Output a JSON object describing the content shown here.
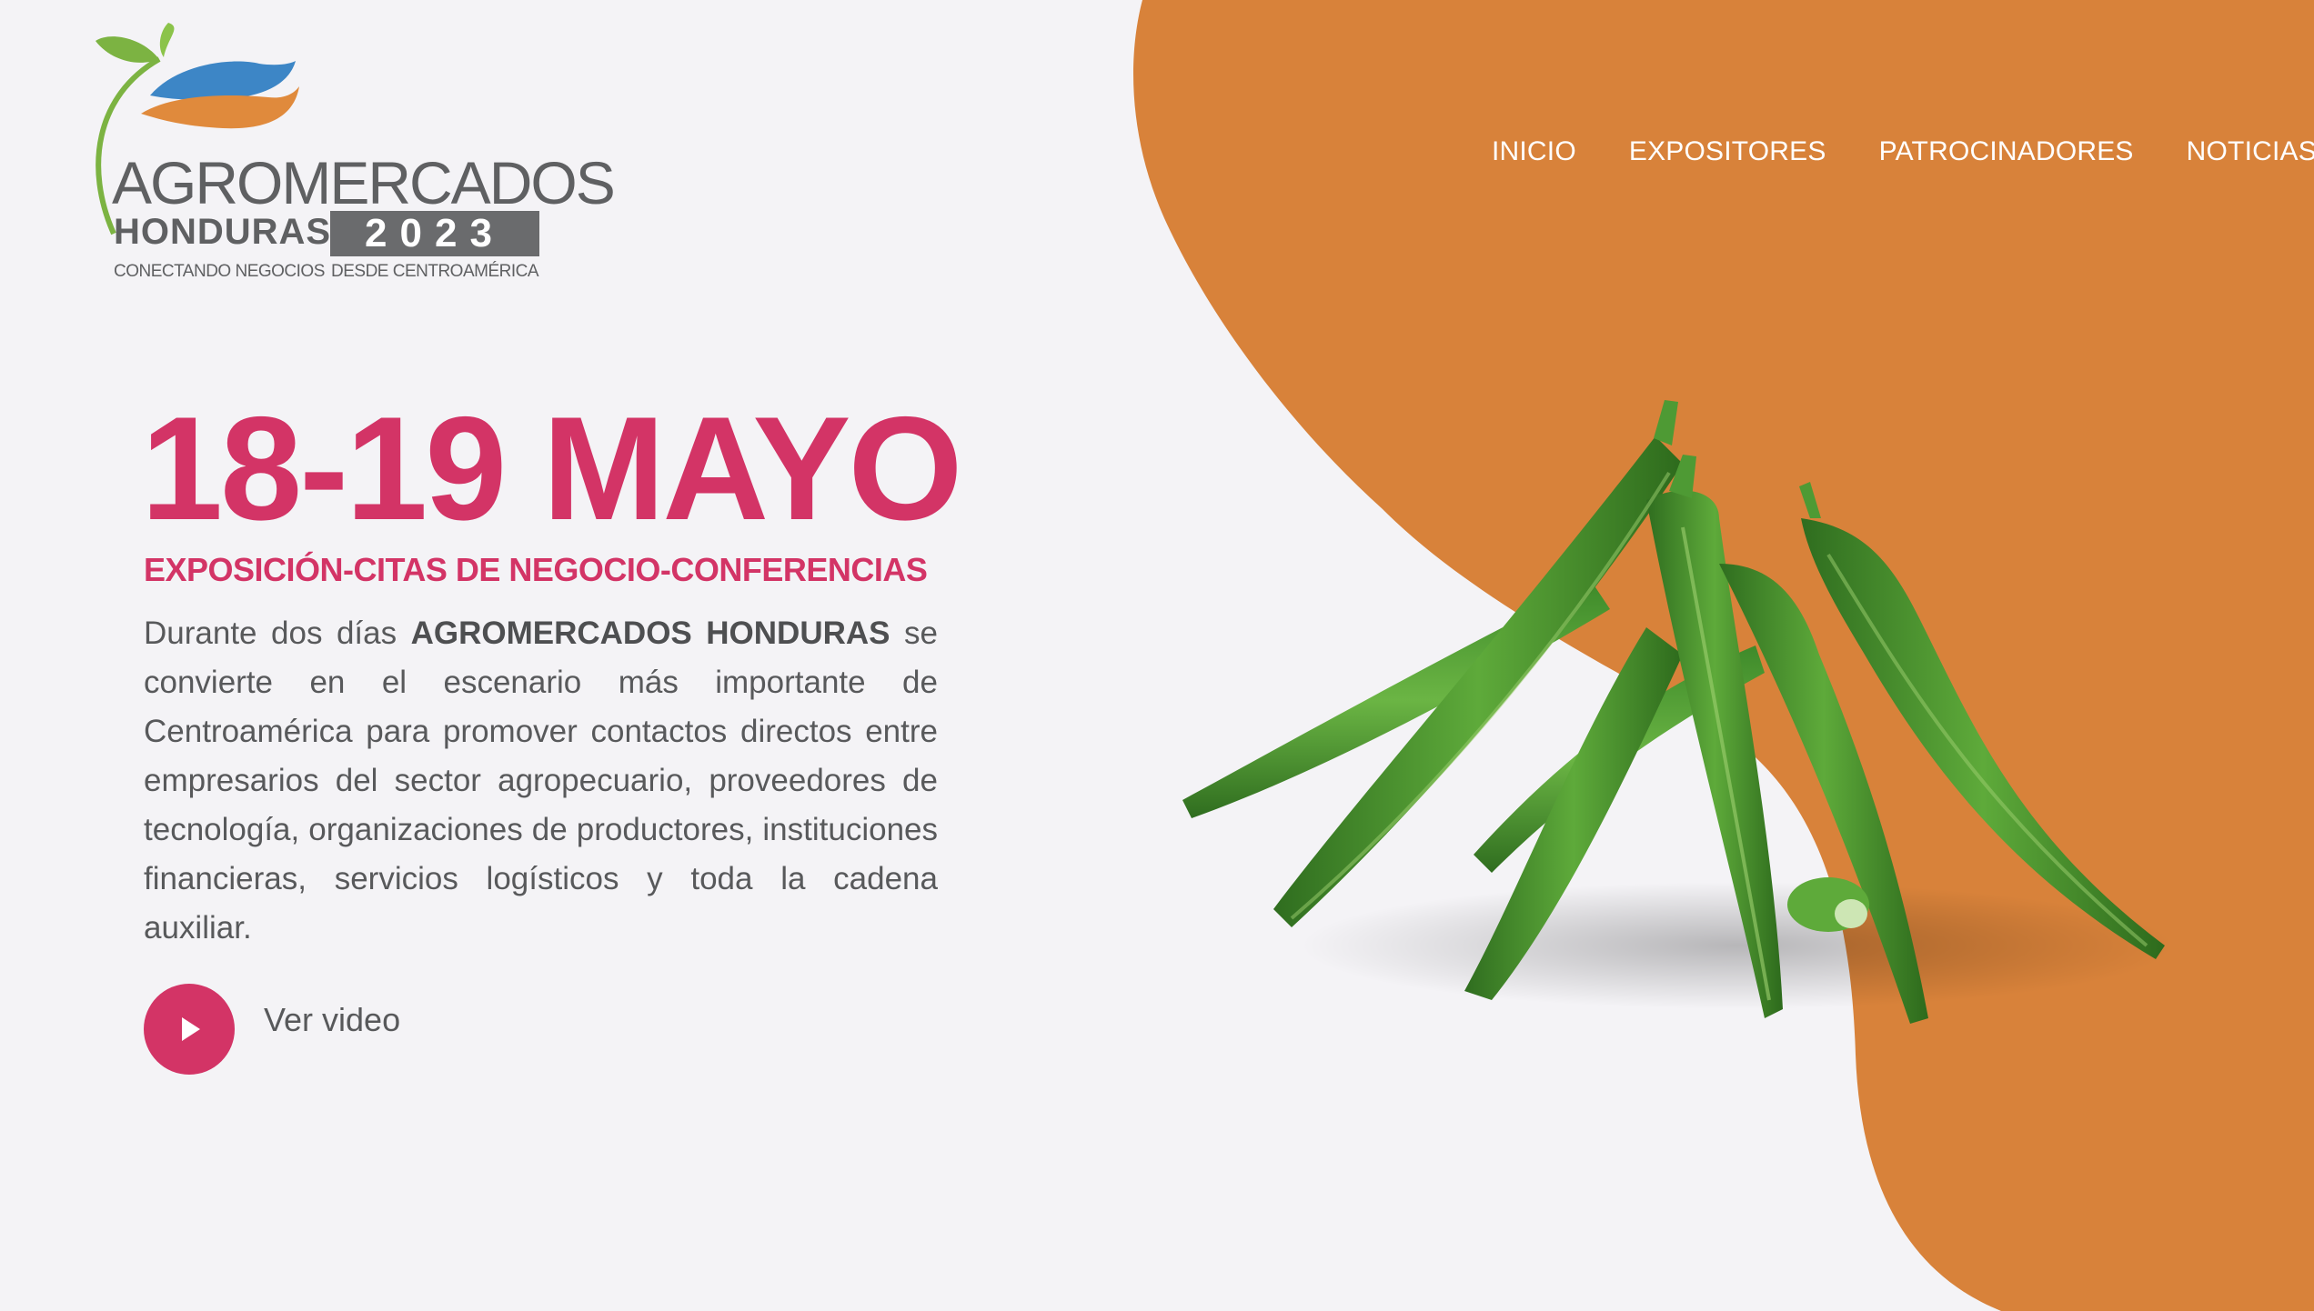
{
  "logo": {
    "name": "AGROMERCADOS",
    "country": "HONDURAS",
    "year": "2023",
    "tagline_left": "CONECTANDO NEGOCIOS",
    "tagline_right": "DESDE CENTROAMÉRICA"
  },
  "nav": {
    "items": [
      {
        "label": "INICIO"
      },
      {
        "label": "EXPOSITORES"
      },
      {
        "label": "PATROCINADORES"
      },
      {
        "label": "NOTICIAS"
      }
    ]
  },
  "hero": {
    "dates": "18-19 MAYO",
    "subtitle": "EXPOSICIÓN-CITAS DE NEGOCIO-CONFERENCIAS",
    "body_prefix": "Durante dos días ",
    "body_bold": "AGROMERCADOS HONDURAS",
    "body_suffix": " se convierte en el escenario más importante de Centroamérica para promover contactos directos entre empresarios del sector agropecuario, proveedores de tecnología, organizaciones de productores, instituciones financieras, servicios logísticos y toda la cadena auxiliar.",
    "video_label": "Ver video"
  },
  "colors": {
    "background": "#f4f3f6",
    "accent_orange": "#d8823a",
    "accent_pink": "#d33466",
    "text_gray": "#58595b",
    "okra_green": "#4e9a34"
  },
  "icons": {
    "play": "play-icon",
    "logo_mark": "sprout-leaf-icon"
  }
}
